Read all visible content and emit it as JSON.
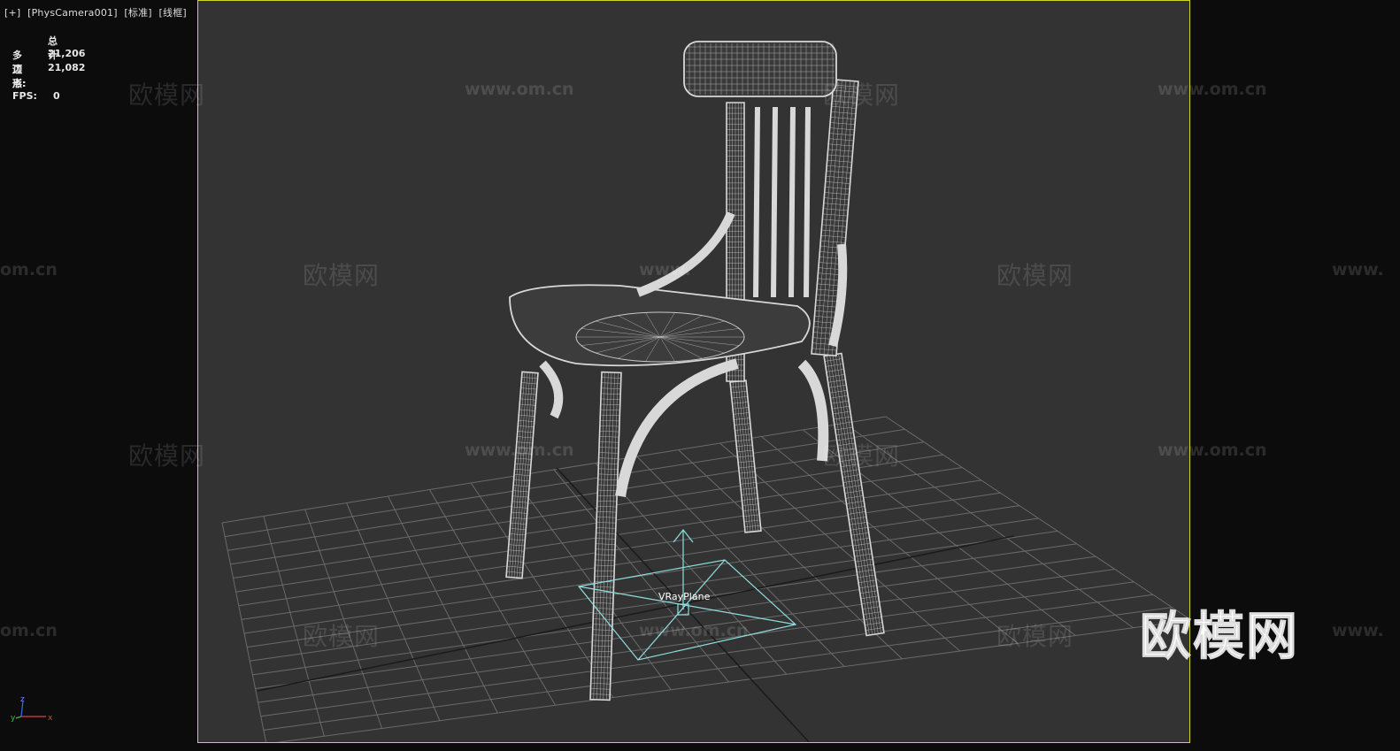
{
  "viewport": {
    "menu": "[+]",
    "camera": "[PhysCamera001]",
    "shading": "[标准]",
    "display_mode": "[线框]"
  },
  "stats": {
    "title": "总计",
    "polygons_label": "多边形:",
    "polygons_value": "21,206",
    "vertices_label": "顶点:",
    "vertices_value": "21,082",
    "fps_label": "FPS:",
    "fps_value": "0"
  },
  "scene": {
    "object_label": "VRayPlane",
    "wireframe_color": "#d8d8d8",
    "grid_color": "#6a6a6a",
    "helper_color": "#8fdede",
    "background_color": "#333333",
    "frame_color": "#d4d42a"
  },
  "watermark": {
    "cn": "欧模网",
    "url": "www.om.cn",
    "url_partial_left": "om.cn",
    "url_partial_right": "www.",
    "logo": "欧模网"
  },
  "gizmo": {
    "x": "x",
    "y": "y",
    "z": "z"
  }
}
